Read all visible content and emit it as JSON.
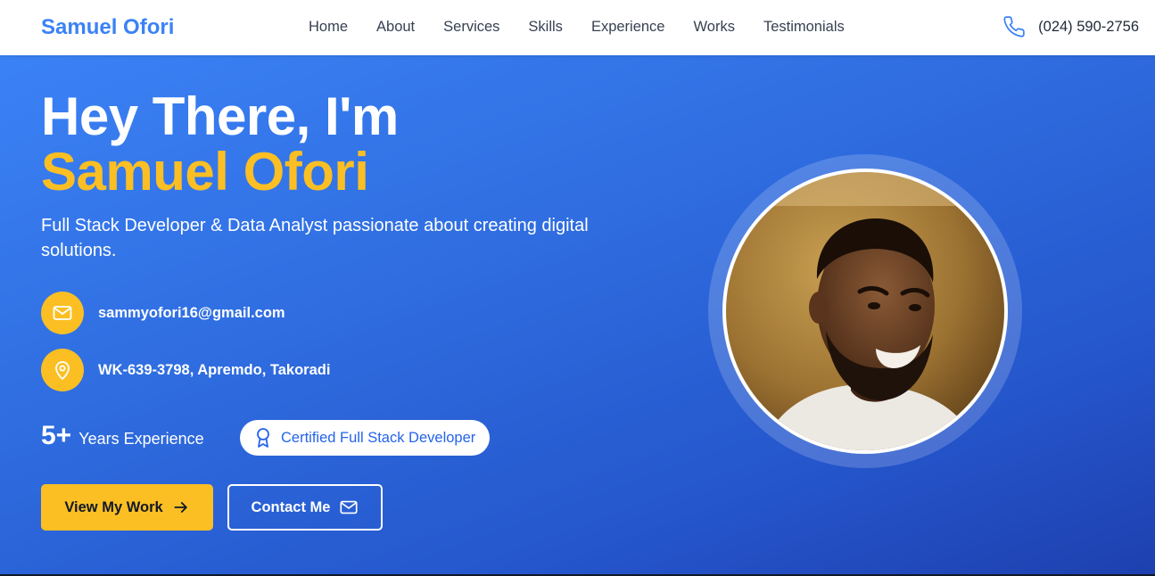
{
  "header": {
    "brand": "Samuel Ofori",
    "nav": [
      "Home",
      "About",
      "Services",
      "Skills",
      "Experience",
      "Works",
      "Testimonials"
    ],
    "phone": "(024) 590-2756",
    "phone_icon": "phone-icon"
  },
  "hero": {
    "greeting": "Hey There, I'm",
    "name": "Samuel Ofori",
    "tagline": "Full Stack Developer & Data Analyst passionate about creating digital solutions.",
    "contacts": [
      {
        "icon": "mail-icon",
        "text": "sammyofori16@gmail.com"
      },
      {
        "icon": "map-pin-icon",
        "text": "WK-639-3798, Apremdo, Takoradi"
      }
    ],
    "experience_number": "5+",
    "experience_label": "Years Experience",
    "certification": "Certified Full Stack Developer",
    "certification_icon": "award-icon",
    "primary_button": "View My Work",
    "secondary_button": "Contact Me",
    "portrait_alt": "portrait photo"
  },
  "colors": {
    "brand_blue": "#3b82f6",
    "accent_yellow": "#fbbf24",
    "hero_gradient_start": "#3b82f6",
    "hero_gradient_end": "#1e40af",
    "text_dark": "#111827",
    "white": "#ffffff"
  }
}
